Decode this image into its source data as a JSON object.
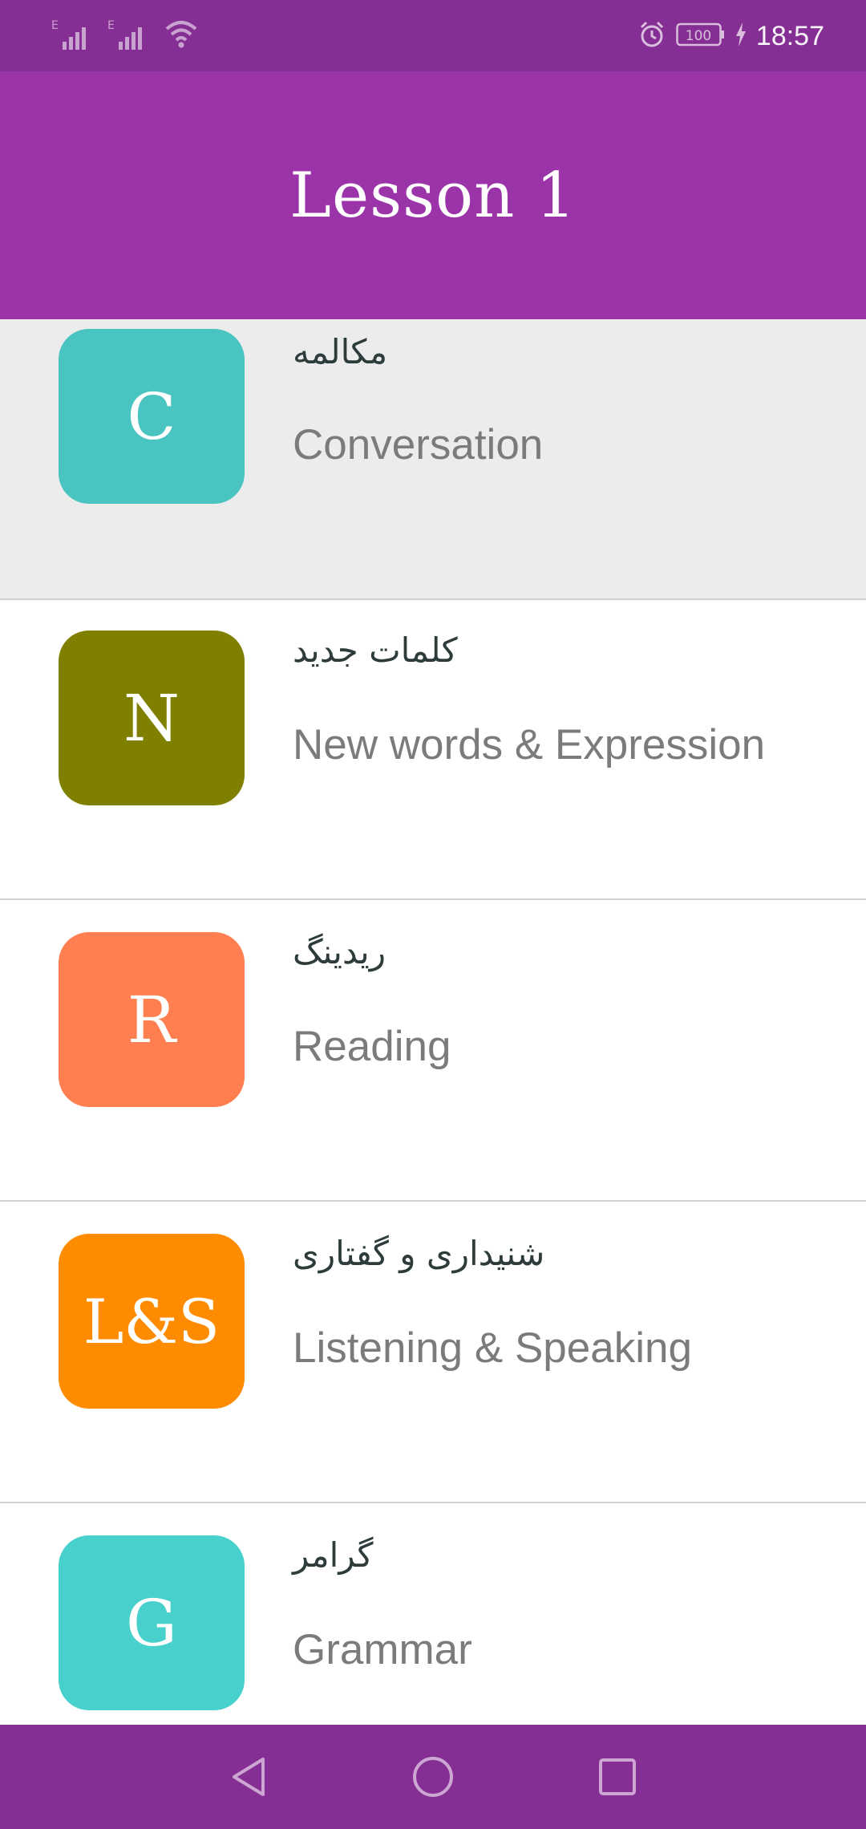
{
  "status_bar": {
    "time": "18:57",
    "battery": "100",
    "icons": [
      "signal-e-icon",
      "signal-e-icon",
      "wifi-icon",
      "alarm-icon",
      "battery-icon",
      "charging-icon"
    ]
  },
  "app_bar": {
    "title": "Lesson 1"
  },
  "items": [
    {
      "letter": "C",
      "fa_title": "مکالمه",
      "en_title": "Conversation",
      "color": "#4ac4c1",
      "selected": true
    },
    {
      "letter": "N",
      "fa_title": "کلمات جدید",
      "en_title": "New words & Expression",
      "color": "#808000",
      "selected": false
    },
    {
      "letter": "R",
      "fa_title": "ریدینگ",
      "en_title": "Reading",
      "color": "#ff7f50",
      "selected": false
    },
    {
      "letter": "L&S",
      "fa_title": "شنیداری و گفتاری",
      "en_title": "Listening & Speaking",
      "color": "#ff8c00",
      "selected": false
    },
    {
      "letter": "G",
      "fa_title": "گرامر",
      "en_title": "Grammar",
      "color": "#48d1cc",
      "selected": false
    }
  ],
  "nav_bar": {
    "buttons": [
      "back-icon",
      "home-icon",
      "recents-icon"
    ]
  },
  "colors": {
    "status_bar": "#852e93",
    "app_bar": "#9b33a9",
    "selected_row": "#ececec",
    "divider": "#cfcfcf"
  }
}
